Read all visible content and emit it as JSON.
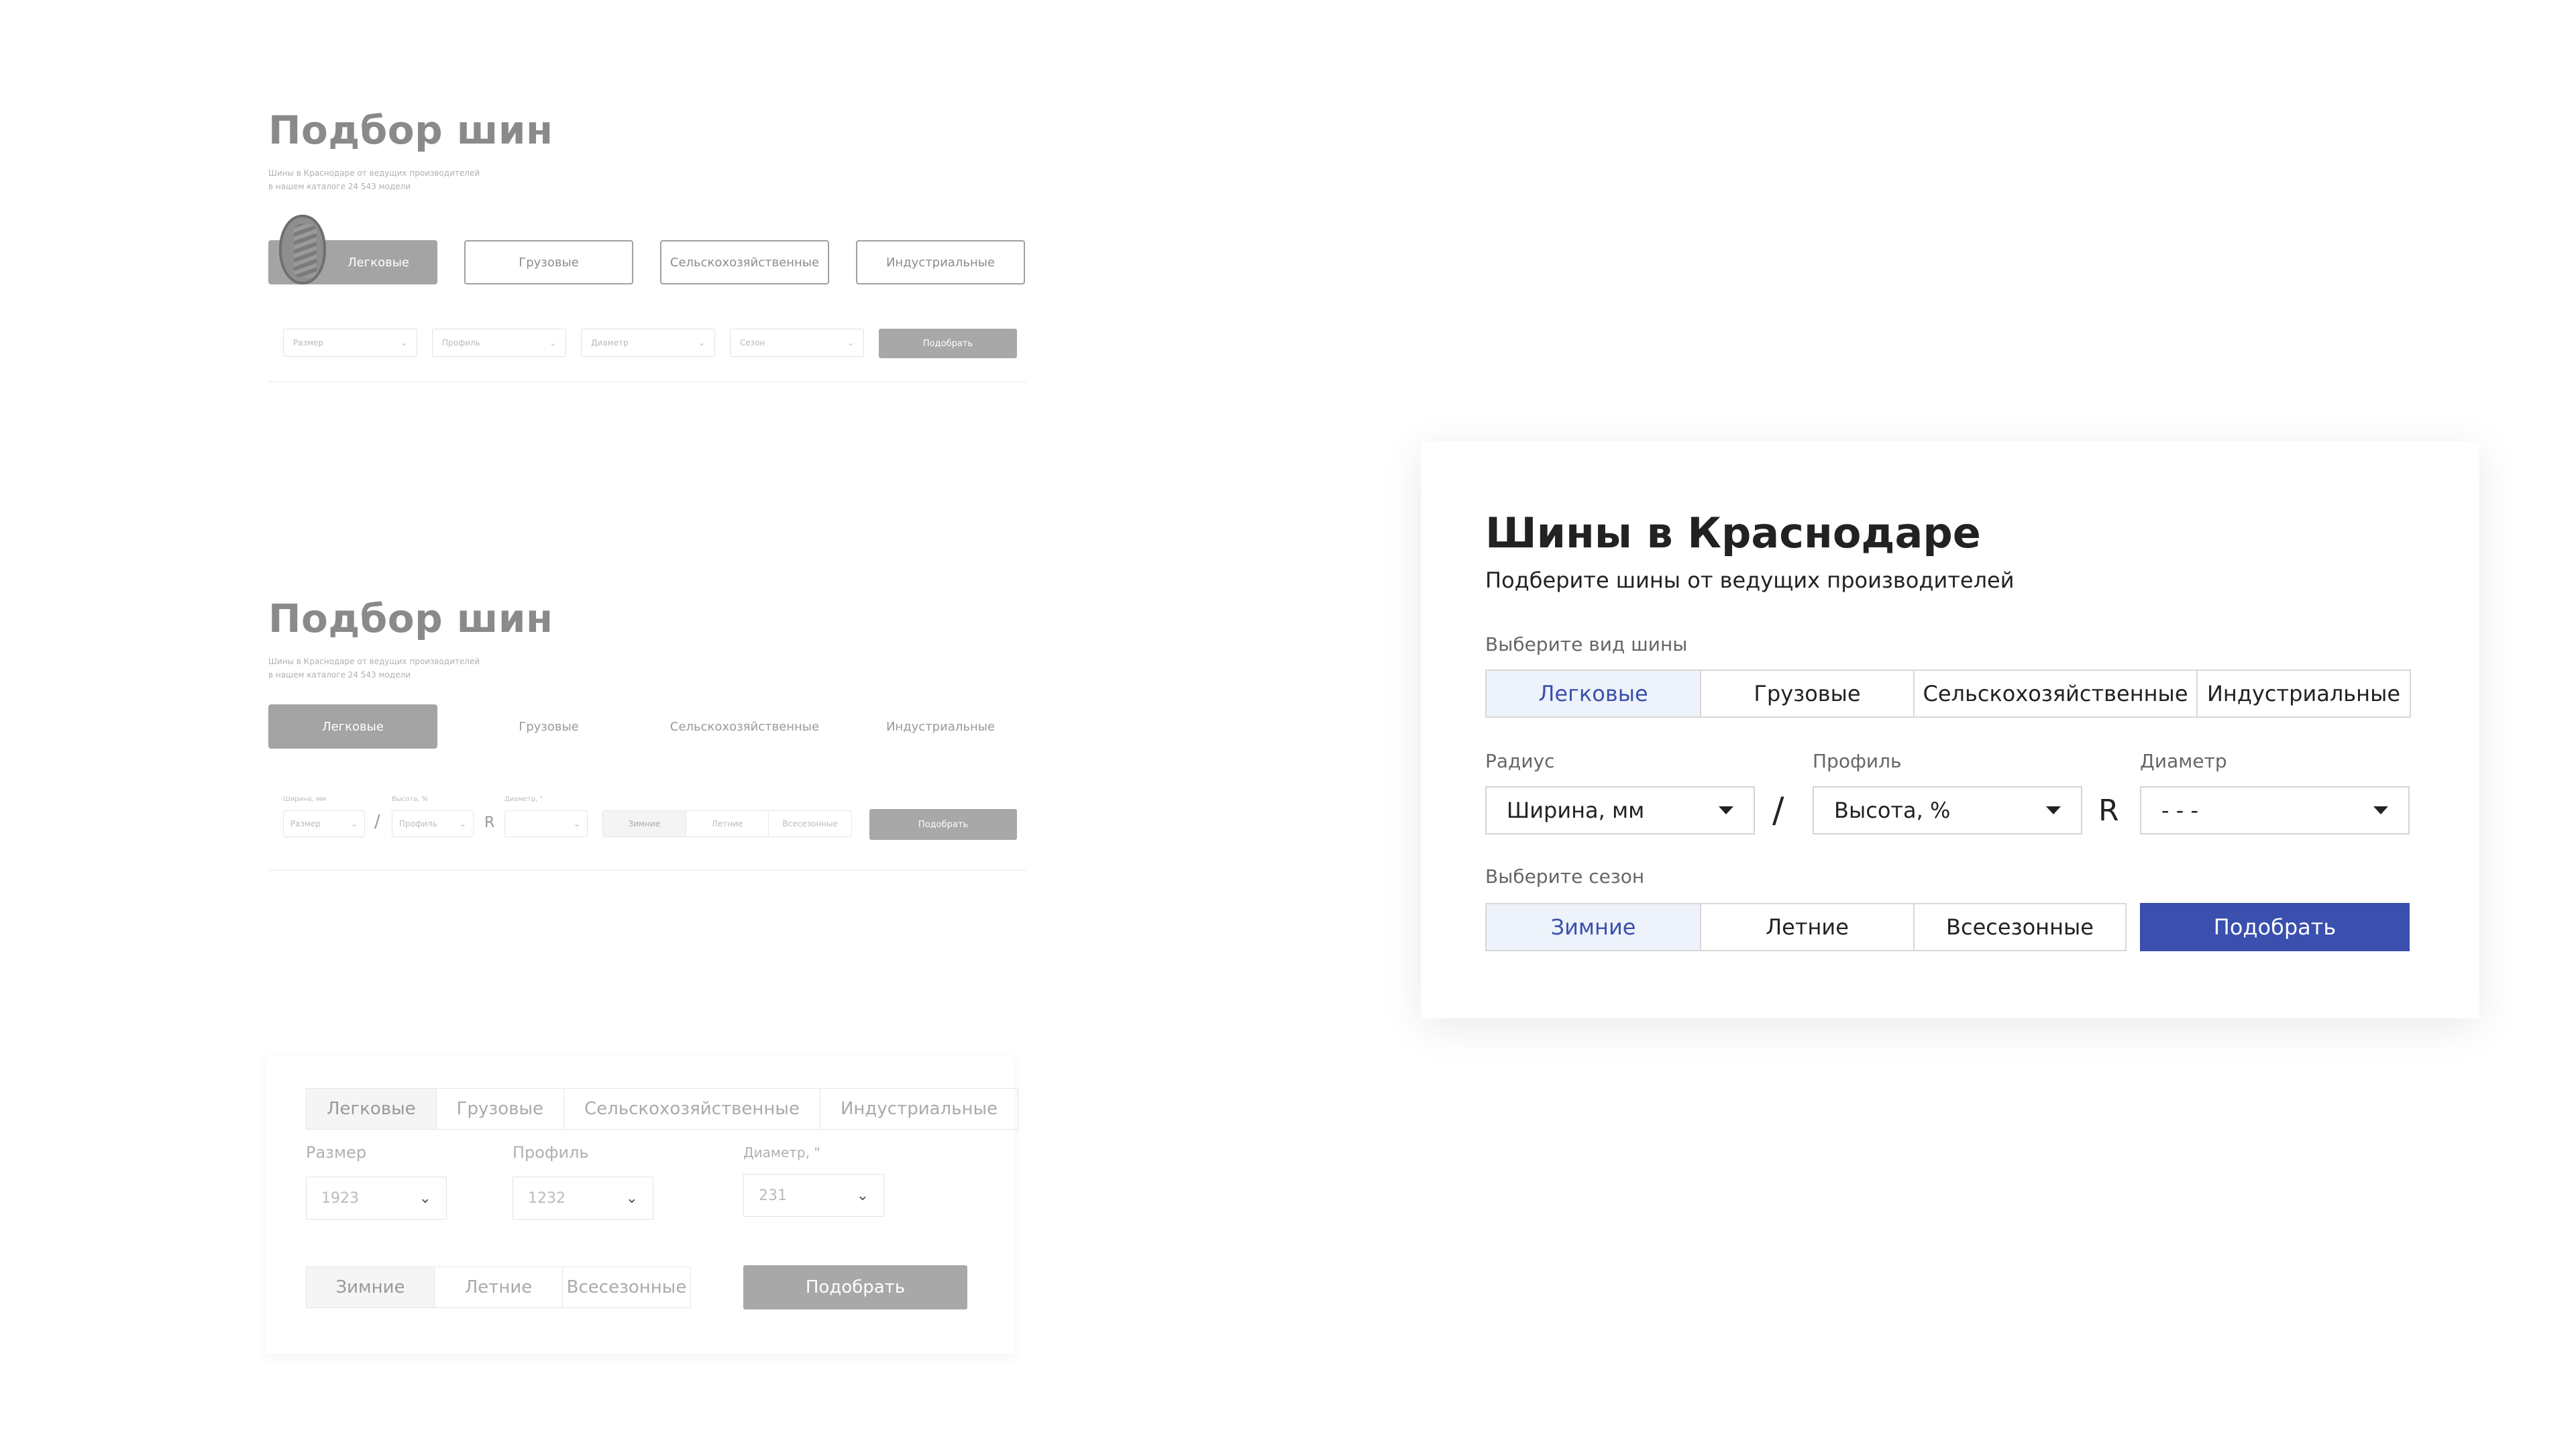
{
  "draft1": {
    "title": "Подбор шин",
    "subtitle_line1": "Шины в Краснодаре от ведущих производителей",
    "subtitle_line2": "в нашем каталоге 24 543 модели",
    "tabs": [
      "Легковые",
      "Грузовые",
      "Сельскохозяйственные",
      "Индустриальные"
    ],
    "filters": [
      "Размер",
      "Профиль",
      "Диаметр",
      "Сезон"
    ],
    "button": "Подобрать"
  },
  "draft2": {
    "title": "Подбор шин",
    "subtitle_line1": "Шины в Краснодаре от ведущих производителей",
    "subtitle_line2": "в нашем каталоге 24 543 модели",
    "tabs": [
      "Легковые",
      "Грузовые",
      "Сельскохозяйственные",
      "Индустриальные"
    ],
    "labels": [
      "Ширина, мм",
      "Высота, %",
      "Диаметр, \""
    ],
    "filters": [
      "Размер",
      "Профиль"
    ],
    "sep_slash": "/",
    "sep_r": "R",
    "seasons": [
      "Зимние",
      "Летние",
      "Всесезонные"
    ],
    "button": "Подобрать"
  },
  "draft3": {
    "tabs": [
      "Легковые",
      "Грузовые",
      "Сельскохозяйственные",
      "Индустриальные"
    ],
    "labels": [
      "Размер",
      "Профиль",
      "Диаметр, \""
    ],
    "values": [
      "1923",
      "1232",
      "231"
    ],
    "seasons": [
      "Зимние",
      "Летние",
      "Всесезонные"
    ],
    "button": "Подобрать"
  },
  "final": {
    "title": "Шины в Краснодаре",
    "subtitle": "Подберите шины от ведущих производителей",
    "type_label": "Выберите вид шины",
    "types": [
      "Легковые",
      "Грузовые",
      "Сельскохозяйственные",
      "Индустриальные"
    ],
    "radius_label": "Радиус",
    "profile_label": "Профиль",
    "diameter_label": "Диаметр",
    "width_value": "Ширина, мм",
    "height_value": "Высота, %",
    "diameter_value": "- - -",
    "sep_slash": "/",
    "sep_r": "R",
    "season_label": "Выберите сезон",
    "seasons": [
      "Зимние",
      "Летние",
      "Всесезонные"
    ],
    "button": "Подобрать",
    "accent_color": "#3a4fae"
  }
}
